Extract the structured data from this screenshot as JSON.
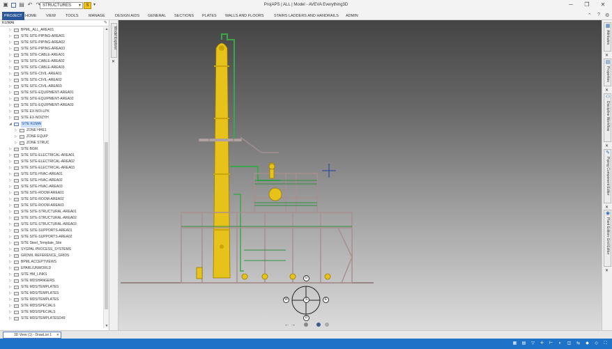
{
  "titlebar": {
    "context_value": "STRUCTURES",
    "context_button": "S",
    "title": "ProjAPS | ALL | Model - AVEVA Everything3D",
    "qat_icons": [
      "app-icon",
      "save-icon",
      "undo-icon",
      "redo-icon",
      "refresh-icon"
    ],
    "min": "─",
    "restore": "❐",
    "close": "✕"
  },
  "ribbon": {
    "tabs": [
      "PROJECT",
      "HOME",
      "VIEW",
      "TOOLS",
      "MANAGE",
      "DESIGN AIDS",
      "GENERAL",
      "SECTIONS",
      "PLATES",
      "WALLS AND FLOORS",
      "STAIRS LADDERS AND HANDRAILS",
      "ADMIN"
    ],
    "active_tab": "PROJECT",
    "accent_color": "#2b579a"
  },
  "explorer": {
    "header": "KUMAI",
    "items": [
      {
        "label": "BPML_ALL_AREA01",
        "level": 0,
        "selected": false
      },
      {
        "label": "SITE SITE-PIPING-AREA01",
        "level": 0,
        "selected": false
      },
      {
        "label": "SITE SITE-PIPING-AREA02",
        "level": 0,
        "selected": false
      },
      {
        "label": "SITE SITE-PIPING-AREA03",
        "level": 0,
        "selected": false
      },
      {
        "label": "SITE SITE-CABLE-AREA01",
        "level": 0,
        "selected": false
      },
      {
        "label": "SITE SITE-CABLE-AREA02",
        "level": 0,
        "selected": false
      },
      {
        "label": "SITE SITE-CABLE-AREA03",
        "level": 0,
        "selected": false
      },
      {
        "label": "SITE SITE-CIVIL-AREA01",
        "level": 0,
        "selected": false
      },
      {
        "label": "SITE SITE-CIVIL-AREA02",
        "level": 0,
        "selected": false
      },
      {
        "label": "SITE SITE-CIVIL-AREA03",
        "level": 0,
        "selected": false
      },
      {
        "label": "SITE SITE-EQUIPMENT-AREA01",
        "level": 0,
        "selected": false
      },
      {
        "label": "SITE SITE-EQUIPMENT-AREA02",
        "level": 0,
        "selected": false
      },
      {
        "label": "SITE SITE-EQUIPMENT-AREA03",
        "level": 0,
        "selected": false
      },
      {
        "label": "SITE EX-NOI-LPK",
        "level": 0,
        "selected": false
      },
      {
        "label": "SITE EX-NOIZYH",
        "level": 0,
        "selected": false
      },
      {
        "label": "SITE KUMAI",
        "level": 0,
        "selected": true
      },
      {
        "label": "ZONE HHE1",
        "level": 1,
        "selected": false
      },
      {
        "label": "ZONE EQUIP",
        "level": 1,
        "selected": false
      },
      {
        "label": "ZONE STRUC",
        "level": 1,
        "selected": false
      },
      {
        "label": "SITE BGM",
        "level": 0,
        "selected": false
      },
      {
        "label": "SITE SITE-ELECTRICAL-AREA01",
        "level": 0,
        "selected": false
      },
      {
        "label": "SITE SITE-ELECTRICAL-AREA02",
        "level": 0,
        "selected": false
      },
      {
        "label": "SITE SITE-ELECTRICAL-AREA03",
        "level": 0,
        "selected": false
      },
      {
        "label": "SITE SITE-HVAC-AREA01",
        "level": 0,
        "selected": false
      },
      {
        "label": "SITE SITE-HVAC-AREA02",
        "level": 0,
        "selected": false
      },
      {
        "label": "SITE SITE-HVAC-AREA03",
        "level": 0,
        "selected": false
      },
      {
        "label": "SITE SITE-ROOM-AREA01",
        "level": 0,
        "selected": false
      },
      {
        "label": "SITE SITE-ROOM-AREA02",
        "level": 0,
        "selected": false
      },
      {
        "label": "SITE SITE-ROOM-AREA03",
        "level": 0,
        "selected": false
      },
      {
        "label": "SITE SITE-STRUCTURAL-AREA01",
        "level": 0,
        "selected": false
      },
      {
        "label": "SITE SITE-STRUCTURAL-AREA02",
        "level": 0,
        "selected": false
      },
      {
        "label": "SITE SITE-STRUCTURAL-AREA03",
        "level": 0,
        "selected": false
      },
      {
        "label": "SITE SITE-SUPPORTS-AREA01",
        "level": 0,
        "selected": false
      },
      {
        "label": "SITE SITE-SUPPORTS-AREA02",
        "level": 0,
        "selected": false
      },
      {
        "label": "SITE Steel_Template_Site",
        "level": 0,
        "selected": false
      },
      {
        "label": "SYGPAL PROCESS_SYSTEMS",
        "level": 0,
        "selected": false
      },
      {
        "label": "GRDWL REFERENCE_GRIDS",
        "level": 0,
        "selected": false
      },
      {
        "label": "BPML ACCEPTVIEWS",
        "level": 0,
        "selected": false
      },
      {
        "label": "EPARL/UNWORLD",
        "level": 0,
        "selected": false
      },
      {
        "label": "SITE HM_LINKS",
        "level": 0,
        "selected": false
      },
      {
        "label": "SITE MDSHANGERS",
        "level": 0,
        "selected": false
      },
      {
        "label": "SITE MDS/TEMPLATES",
        "level": 0,
        "selected": false
      },
      {
        "label": "SITE MDS/TEMPLATES",
        "level": 0,
        "selected": false
      },
      {
        "label": "SITE MDS/TEMPLATES",
        "level": 0,
        "selected": false
      },
      {
        "label": "SITE MDS/SPECIALS",
        "level": 0,
        "selected": false
      },
      {
        "label": "SITE MDS/SPECIALS",
        "level": 0,
        "selected": false
      },
      {
        "label": "SITE MDS/TEMPLATESD49",
        "level": 0,
        "selected": false
      }
    ]
  },
  "left_sidetab": {
    "label": "Model Explorer",
    "close": "✕"
  },
  "right_panels": [
    {
      "label": "Attributes",
      "icon": "attributes-icon"
    },
    {
      "label": "Properties",
      "icon": "properties-icon"
    },
    {
      "label": "Discipline Workflow",
      "icon": "discipline-workflow-icon"
    },
    {
      "label": "Piping Component Editor",
      "icon": "piping-component-editor-icon"
    },
    {
      "label": "Plant Edition Grid Editor",
      "icon": "grid-editor-icon"
    }
  ],
  "viewcube": {
    "north": "U",
    "south": "D",
    "west": "W",
    "east": "E",
    "center": "S"
  },
  "viewport": {
    "background_top": "#444444",
    "background_bottom": "#dcdcdc",
    "model_colors": {
      "equipment": "#e6c21a",
      "pipe": "#3aa84a",
      "steel": "#a89090",
      "cursor": "#1c3f9e"
    }
  },
  "doc_tab": {
    "label": "3D View (1) - DrawList 1",
    "close": "✕"
  },
  "statusbar": {
    "color": "#1e72c8"
  }
}
